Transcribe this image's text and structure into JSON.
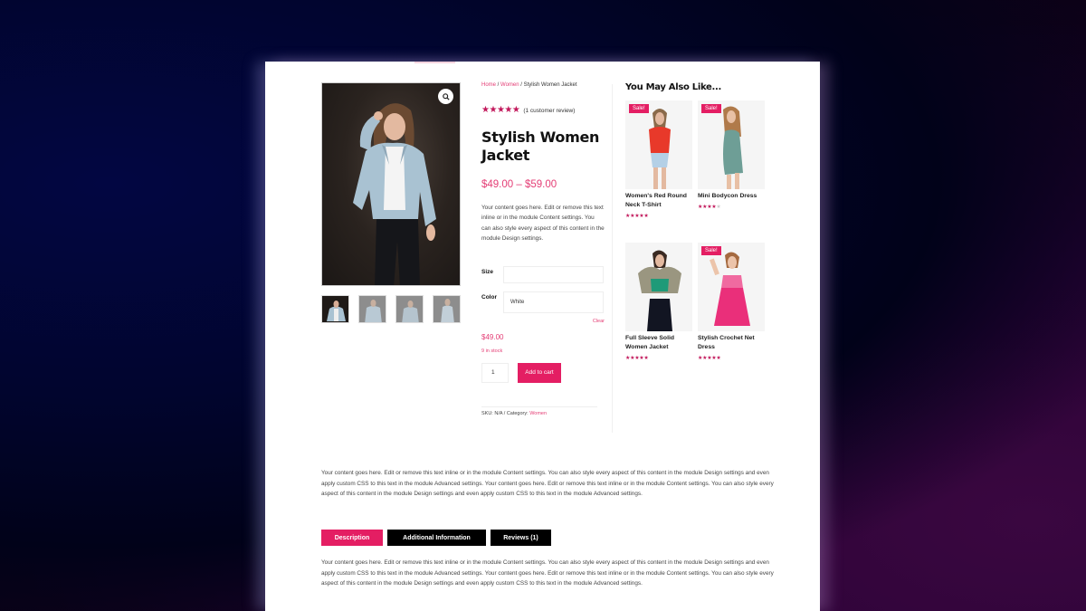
{
  "breadcrumb": {
    "items": [
      "Home",
      "Women"
    ],
    "current": "Stylish Women Jacket",
    "separator": " / "
  },
  "product": {
    "title": "Stylish Women Jacket",
    "rating": 5,
    "rating_max": 5,
    "review_link": "(1 customer review)",
    "price_range": "$49.00 – $59.00",
    "short_description": "Your content goes here. Edit or remove this text inline or in the module Content settings. You can also style every aspect of this content in the module Design settings.",
    "zoom_icon": "magnifier-icon",
    "thumbnail_count": 4
  },
  "variations": {
    "size_label": "Size",
    "size_value": "",
    "color_label": "Color",
    "color_value": "White",
    "clear_label": "Clear"
  },
  "purchase": {
    "variation_price": "$49.00",
    "stock": "9 in stock",
    "quantity": "1",
    "add_to_cart": "Add to cart"
  },
  "meta": {
    "sku_text": "SKU: N/A / Category: ",
    "category": "Women"
  },
  "related": {
    "title": "You May Also Like...",
    "sale_label": "Sale!",
    "items": [
      {
        "name": "Women's Red Round Neck T-Shirt",
        "rating": 5,
        "sale": true
      },
      {
        "name": "Mini Bodycon Dress",
        "rating": 4,
        "sale": true
      },
      {
        "name": "Full Sleeve Solid Women Jacket",
        "rating": 5,
        "sale": false
      },
      {
        "name": "Stylish Crochet Net Dress",
        "rating": 5,
        "sale": true
      }
    ]
  },
  "long_description": "Your content goes here. Edit or remove this text inline or in the module Content settings. You can also style every aspect of this content in the module Design settings and even apply custom CSS to this text in the module Advanced settings. Your content goes here. Edit or remove this text inline or in the module Content settings. You can also style every aspect of this content in the module Design settings and even apply custom CSS to this text in the module Advanced settings.",
  "tabs": [
    {
      "label": "Description",
      "active": true
    },
    {
      "label": "Additional Information",
      "active": false
    },
    {
      "label": "Reviews (1)",
      "active": false
    }
  ],
  "tab_content": "Your content goes here. Edit or remove this text inline or in the module Content settings. You can also style every aspect of this content in the module Design settings and even apply custom CSS to this text in the module Advanced settings. Your content goes here. Edit or remove this text inline or in the module Content settings. You can also style every aspect of this content in the module Design settings and even apply custom CSS to this text in the module Advanced settings.",
  "colors": {
    "accent": "#e41e63",
    "link": "#e43d75",
    "star": "#c2185b"
  }
}
